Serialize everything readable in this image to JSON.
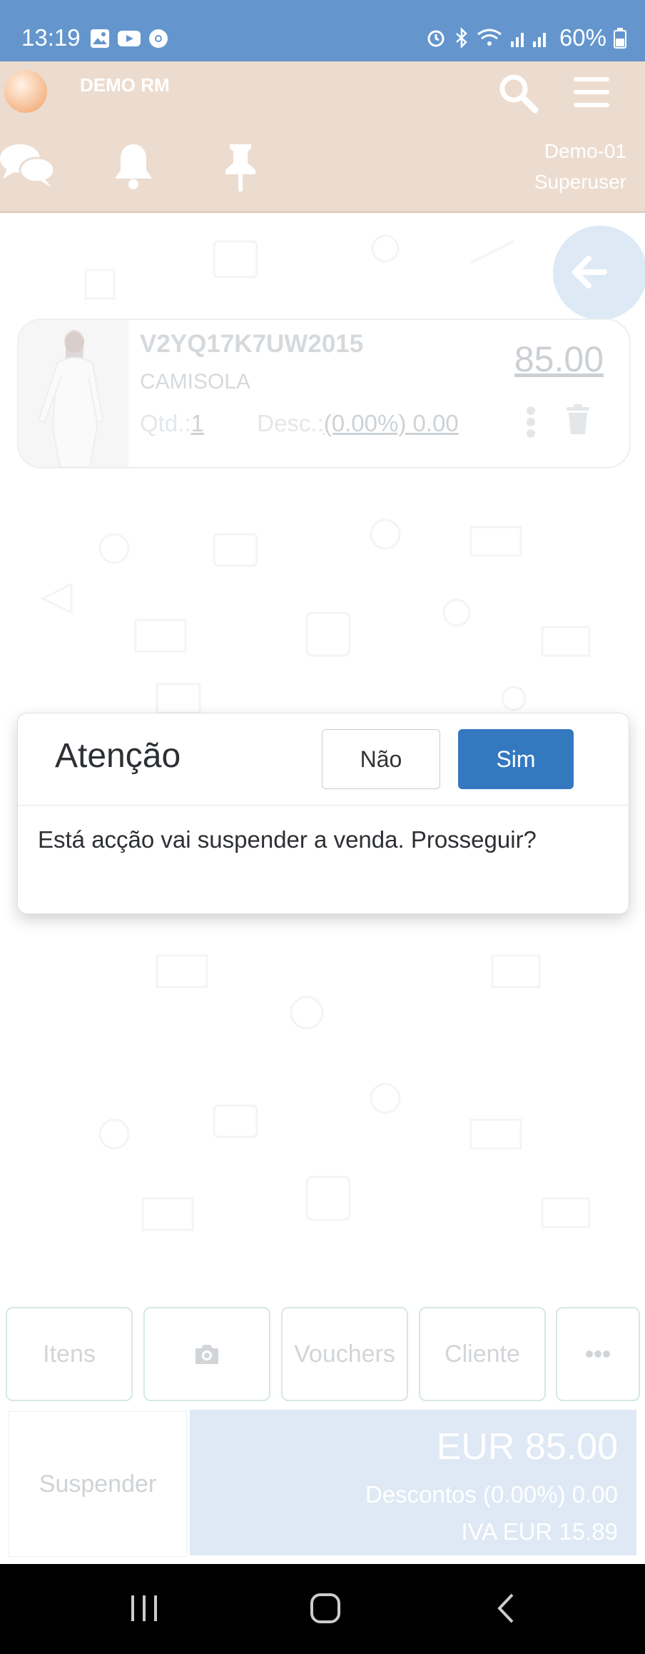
{
  "status_bar": {
    "time": "13:19",
    "battery": "60%"
  },
  "header": {
    "company": "DEMO RM",
    "user_line1": "Demo-01",
    "user_line2": "Superuser"
  },
  "item": {
    "sku": "V2YQ17K7UW2015",
    "name": "CAMISOLA",
    "price": "85.00",
    "qty_label": "Qtd.:",
    "qty_value": "1",
    "disc_label": "Desc.:",
    "disc_value": "(0.00%) 0.00"
  },
  "dialog": {
    "title": "Atenção",
    "no_label": "Não",
    "yes_label": "Sim",
    "message": "Está acção vai suspender a venda. Prosseguir?"
  },
  "tabs": {
    "items": "Itens",
    "vouchers": "Vouchers",
    "client": "Cliente"
  },
  "footer": {
    "suspend": "Suspender",
    "total": "EUR 85.00",
    "discounts": "Descontos  (0.00%) 0.00",
    "vat": "IVA  EUR 15.89"
  },
  "colors": {
    "status_bar": "#6496cd",
    "header": "#ecdccf",
    "primary": "#3479c0",
    "total_panel": "#dee9f5"
  },
  "icons": [
    "chat-icon",
    "bell-icon",
    "pin-icon",
    "search-icon",
    "menu-icon",
    "arrow-left-icon",
    "camera-icon",
    "more-icon",
    "kebab-icon",
    "trash-icon"
  ]
}
